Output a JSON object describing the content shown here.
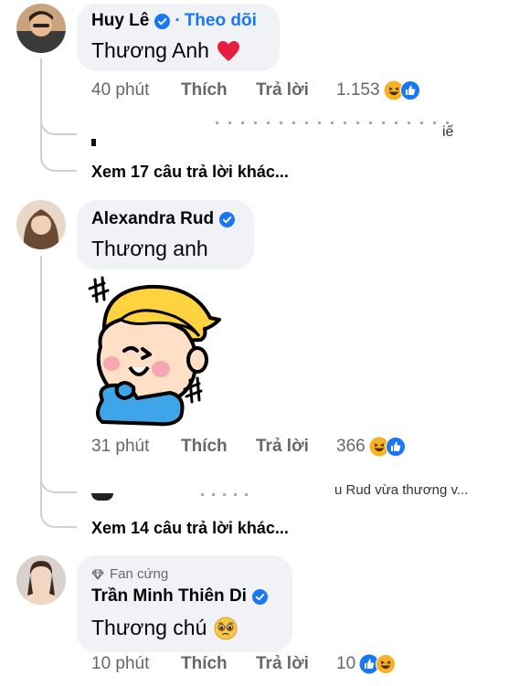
{
  "comments": [
    {
      "author": "Huy Lê",
      "verified": true,
      "dot": "·",
      "follow_label": "Theo dõi",
      "text": "Thương Anh",
      "emoji": "heart",
      "time": "40 phút",
      "like_label": "Thích",
      "reply_label": "Trả lời",
      "reaction_count": "1.153",
      "reactions": [
        "haha",
        "like"
      ],
      "partial_reply_text": "iế",
      "view_more": "Xem 17 câu trả lời khác..."
    },
    {
      "author": "Alexandra Rud",
      "verified": true,
      "text": "Thương anh",
      "sticker": "boy-blushing-sticker",
      "time": "31 phút",
      "like_label": "Thích",
      "reply_label": "Trả lời",
      "reaction_count": "366",
      "reactions": [
        "haha",
        "like"
      ],
      "partial_reply_text": "u Rud vừa thương v...",
      "view_more": "Xem 14 câu trả lời khác..."
    },
    {
      "badge": "Fan cứng",
      "author": "Trần Minh Thiên Di",
      "verified": true,
      "text": "Thương chú",
      "emoji": "pleading-face",
      "time": "10 phút",
      "like_label": "Thích",
      "reply_label": "Trả lời",
      "reaction_count": "10",
      "reactions": [
        "like",
        "haha"
      ]
    }
  ],
  "colors": {
    "link_blue": "#1877f2",
    "bubble_bg": "#f0f2f5",
    "secondary_text": "#65676b",
    "heart": "#e41e3f",
    "haha_yellow": "#f7b125",
    "thread_line": "#ced0d4"
  }
}
